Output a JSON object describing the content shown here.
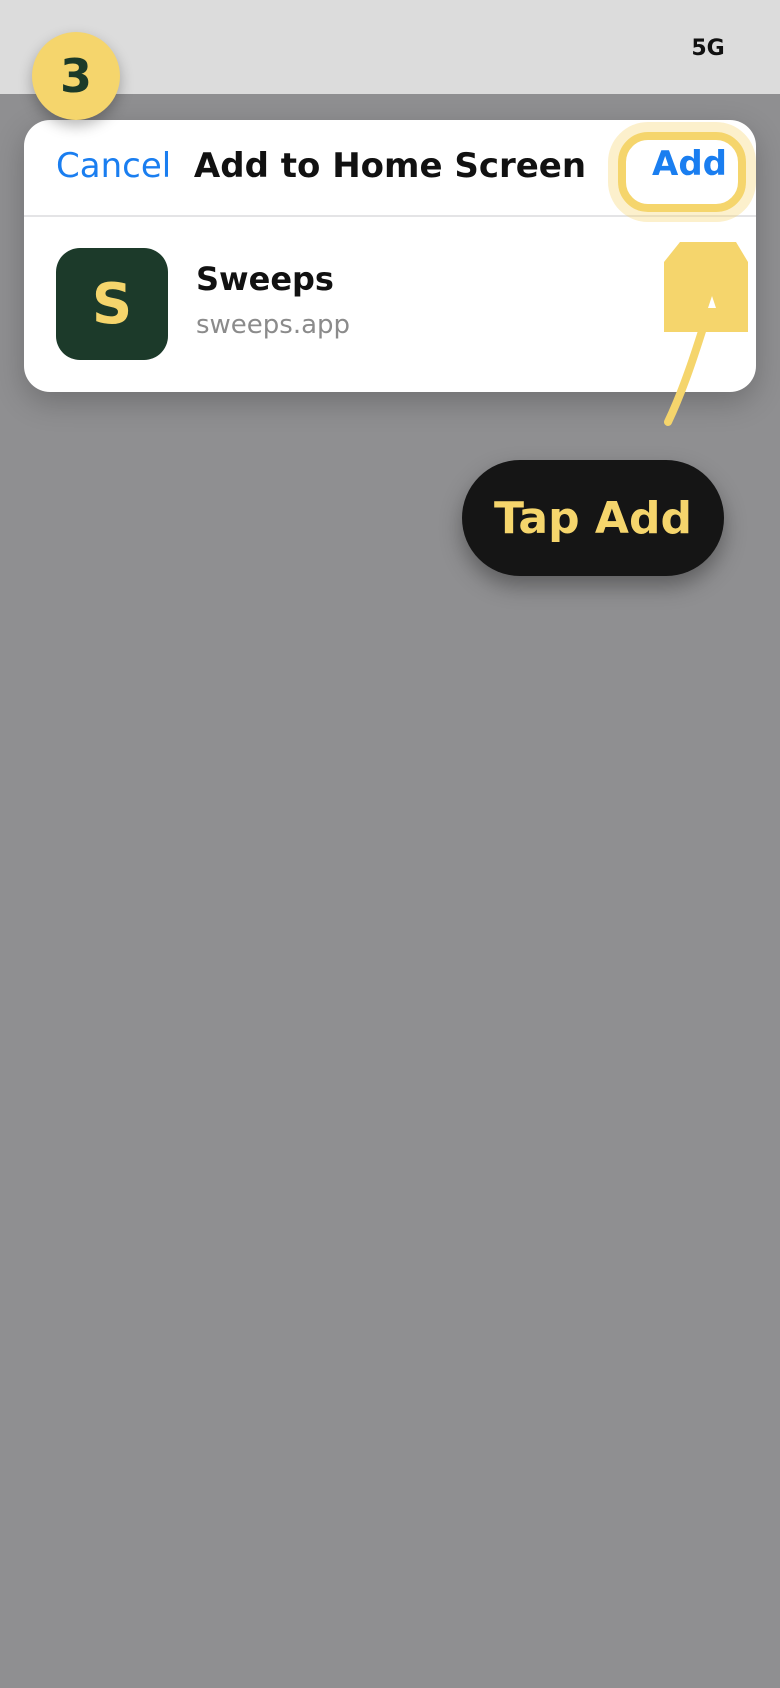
{
  "status_bar": {
    "network": "5G"
  },
  "step_badge": {
    "number": "3"
  },
  "sheet": {
    "cancel_label": "Cancel",
    "title": "Add to Home Screen",
    "add_label": "Add"
  },
  "app": {
    "icon_letter": "S",
    "name": "Sweeps",
    "url": "sweeps.app"
  },
  "callout": {
    "label": "Tap Add"
  },
  "colors": {
    "accent_yellow": "#f5d56c",
    "link_blue": "#1a7ef0",
    "app_icon_green": "#1c3a2a",
    "overlay_gray": "#8f8f91",
    "pill_black": "#151515"
  },
  "icons": {
    "pointer": "curved-arrow-icon"
  }
}
